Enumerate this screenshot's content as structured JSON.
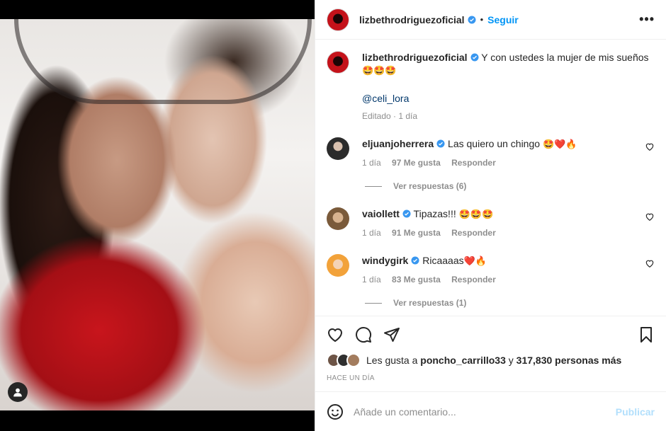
{
  "header": {
    "username": "lizbethrodriguezoficial",
    "separator": "•",
    "follow_label": "Seguir",
    "more_label": "•••"
  },
  "caption": {
    "username": "lizbethrodriguezoficial",
    "text": "Y con ustedes la mujer de mis sueños",
    "emojis": "🤩🤩🤩",
    "mention": "@celi_lora",
    "meta": "Editado · 1 día"
  },
  "comments": [
    {
      "username": "eljuanjoherrera",
      "text": "Las quiero un chingo",
      "emojis": "🤩❤️🔥",
      "time": "1 día",
      "likes": "97 Me gusta",
      "reply": "Responder",
      "view_replies": "Ver respuestas (6)"
    },
    {
      "username": "vaiollett",
      "text": "Tipazas!!!",
      "emojis": "🤩🤩🤩",
      "time": "1 día",
      "likes": "91 Me gusta",
      "reply": "Responder"
    },
    {
      "username": "windygirk",
      "text": "Ricaaaas",
      "emojis": "❤️🔥",
      "time": "1 día",
      "likes": "83 Me gusta",
      "reply": "Responder",
      "view_replies": "Ver respuestas (1)"
    }
  ],
  "likes": {
    "prefix": "Les gusta a",
    "user": "poncho_carrillo33",
    "middle": "y",
    "count": "317,830 personas más"
  },
  "timestamp": "HACE UN DÍA",
  "add_comment": {
    "placeholder": "Añade un comentario...",
    "publish_label": "Publicar"
  },
  "colors": {
    "accent": "#0095f6",
    "verified": "#3897f0",
    "muted": "#8e8e8e"
  }
}
